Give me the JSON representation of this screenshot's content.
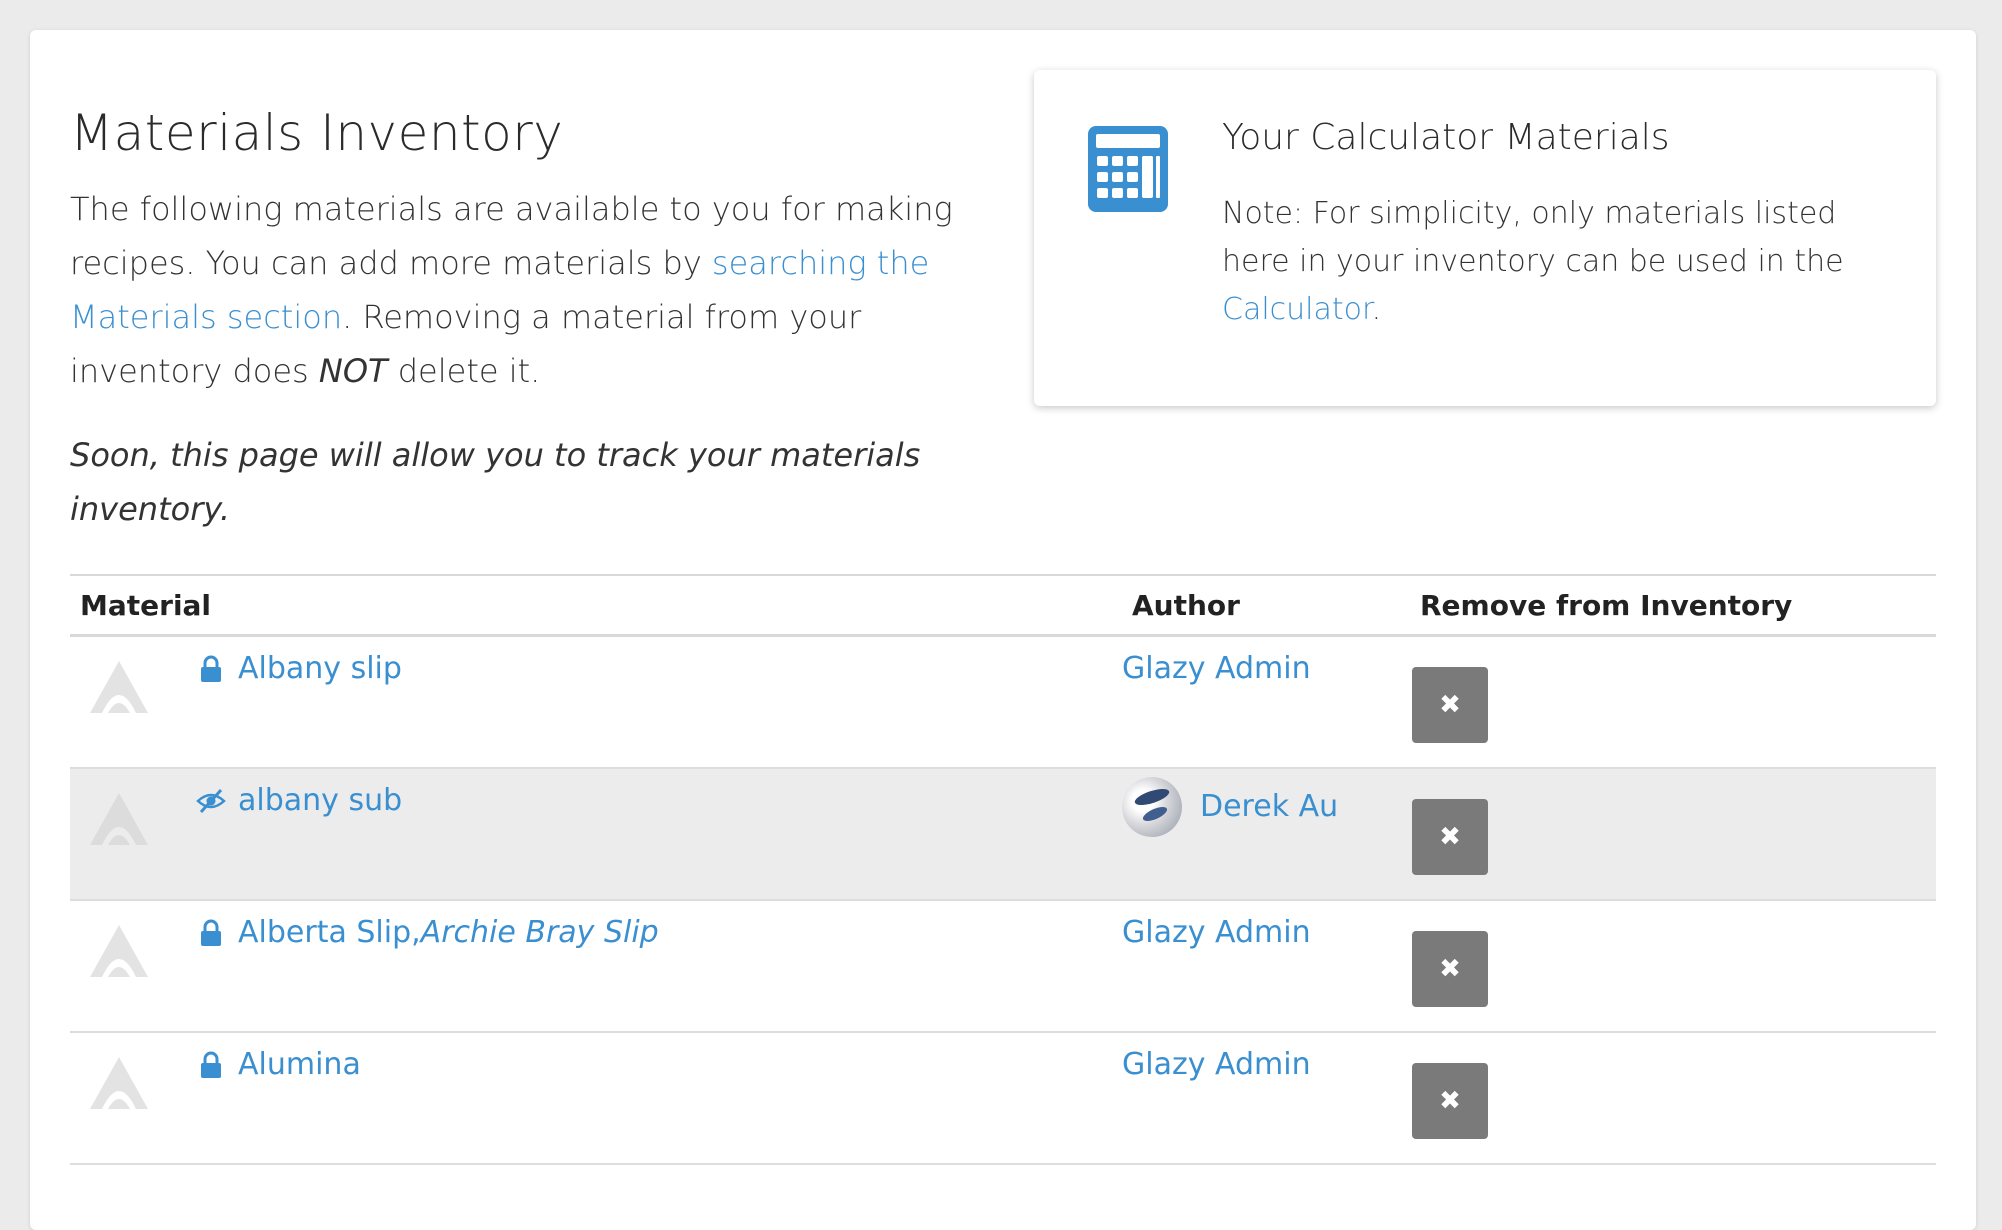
{
  "header": {
    "title": "Materials Inventory"
  },
  "intro": {
    "text_1": "The following materials are available to you for making recipes. You can add more materials by ",
    "link_text": "searching the Materials section",
    "text_2": ". Removing a material from your inventory does ",
    "emphasis": "NOT",
    "text_3": " delete it.",
    "soon_text": "Soon, this page will allow you to track your materials inventory."
  },
  "info_box": {
    "title": "Your Calculator Materials",
    "note_text": "Note: For simplicity, only materials listed here in your inventory can be used in the ",
    "link_text": "Calculator",
    "note_end": ".",
    "icon": "calculator-icon",
    "icon_color": "#3a8fd1"
  },
  "table": {
    "headers": {
      "material": "Material",
      "author": "Author",
      "remove": "Remove from Inventory"
    },
    "rows": [
      {
        "name": "Albany slip",
        "alias": "",
        "status": "lock-icon",
        "author": "Glazy Admin",
        "remove_label": "✖"
      },
      {
        "name": "albany sub",
        "alias": "",
        "status": "eye-slash-icon",
        "author": "Derek Au",
        "remove_label": "✖"
      },
      {
        "name": "Alberta Slip, ",
        "alias": "Archie Bray Slip",
        "status": "lock-icon",
        "author": "Glazy Admin",
        "remove_label": "✖"
      },
      {
        "name": "Alumina",
        "alias": "",
        "status": "lock-icon",
        "author": "Glazy Admin",
        "remove_label": "✖"
      }
    ]
  },
  "colors": {
    "link": "#3a8fd1",
    "remove_button": "#7a7a7a",
    "shaded_row": "#ececec",
    "background": "#ebebeb"
  }
}
